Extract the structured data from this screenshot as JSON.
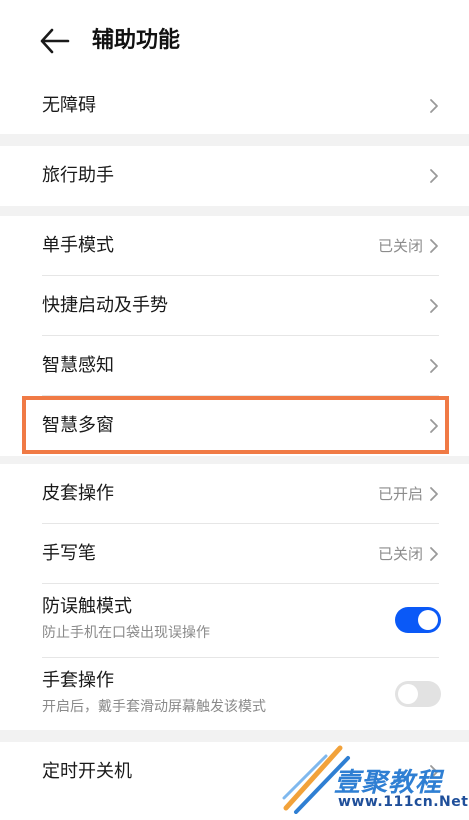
{
  "header": {
    "title": "辅助功能"
  },
  "groups": {
    "g1": {
      "row1": {
        "label": "无障碍"
      }
    },
    "g2": {
      "row1": {
        "label": "旅行助手"
      }
    },
    "g3": {
      "row1": {
        "label": "单手模式",
        "status": "已关闭"
      },
      "row2": {
        "label": "快捷启动及手势"
      },
      "row3": {
        "label": "智慧感知"
      },
      "row4": {
        "label": "智慧多窗"
      }
    },
    "g4": {
      "row1": {
        "label": "皮套操作",
        "status": "已开启"
      },
      "row2": {
        "label": "手写笔",
        "status": "已关闭"
      },
      "row3": {
        "label": "防误触模式",
        "sub": "防止手机在口袋出现误操作",
        "toggle": true
      },
      "row4": {
        "label": "手套操作",
        "sub": "开启后，戴手套滑动屏幕触发该模式",
        "toggle": false
      }
    },
    "g5": {
      "row1": {
        "label": "定时开关机"
      }
    }
  },
  "watermark": {
    "line1": "壹聚教程",
    "line2": "www.111cn.Net"
  },
  "colors": {
    "accent": "#0a59f7",
    "highlight": "#f07a45",
    "background": "#f2f2f2"
  },
  "icons": {
    "back": "back-arrow-icon",
    "chevron": "chevron-right-icon"
  }
}
